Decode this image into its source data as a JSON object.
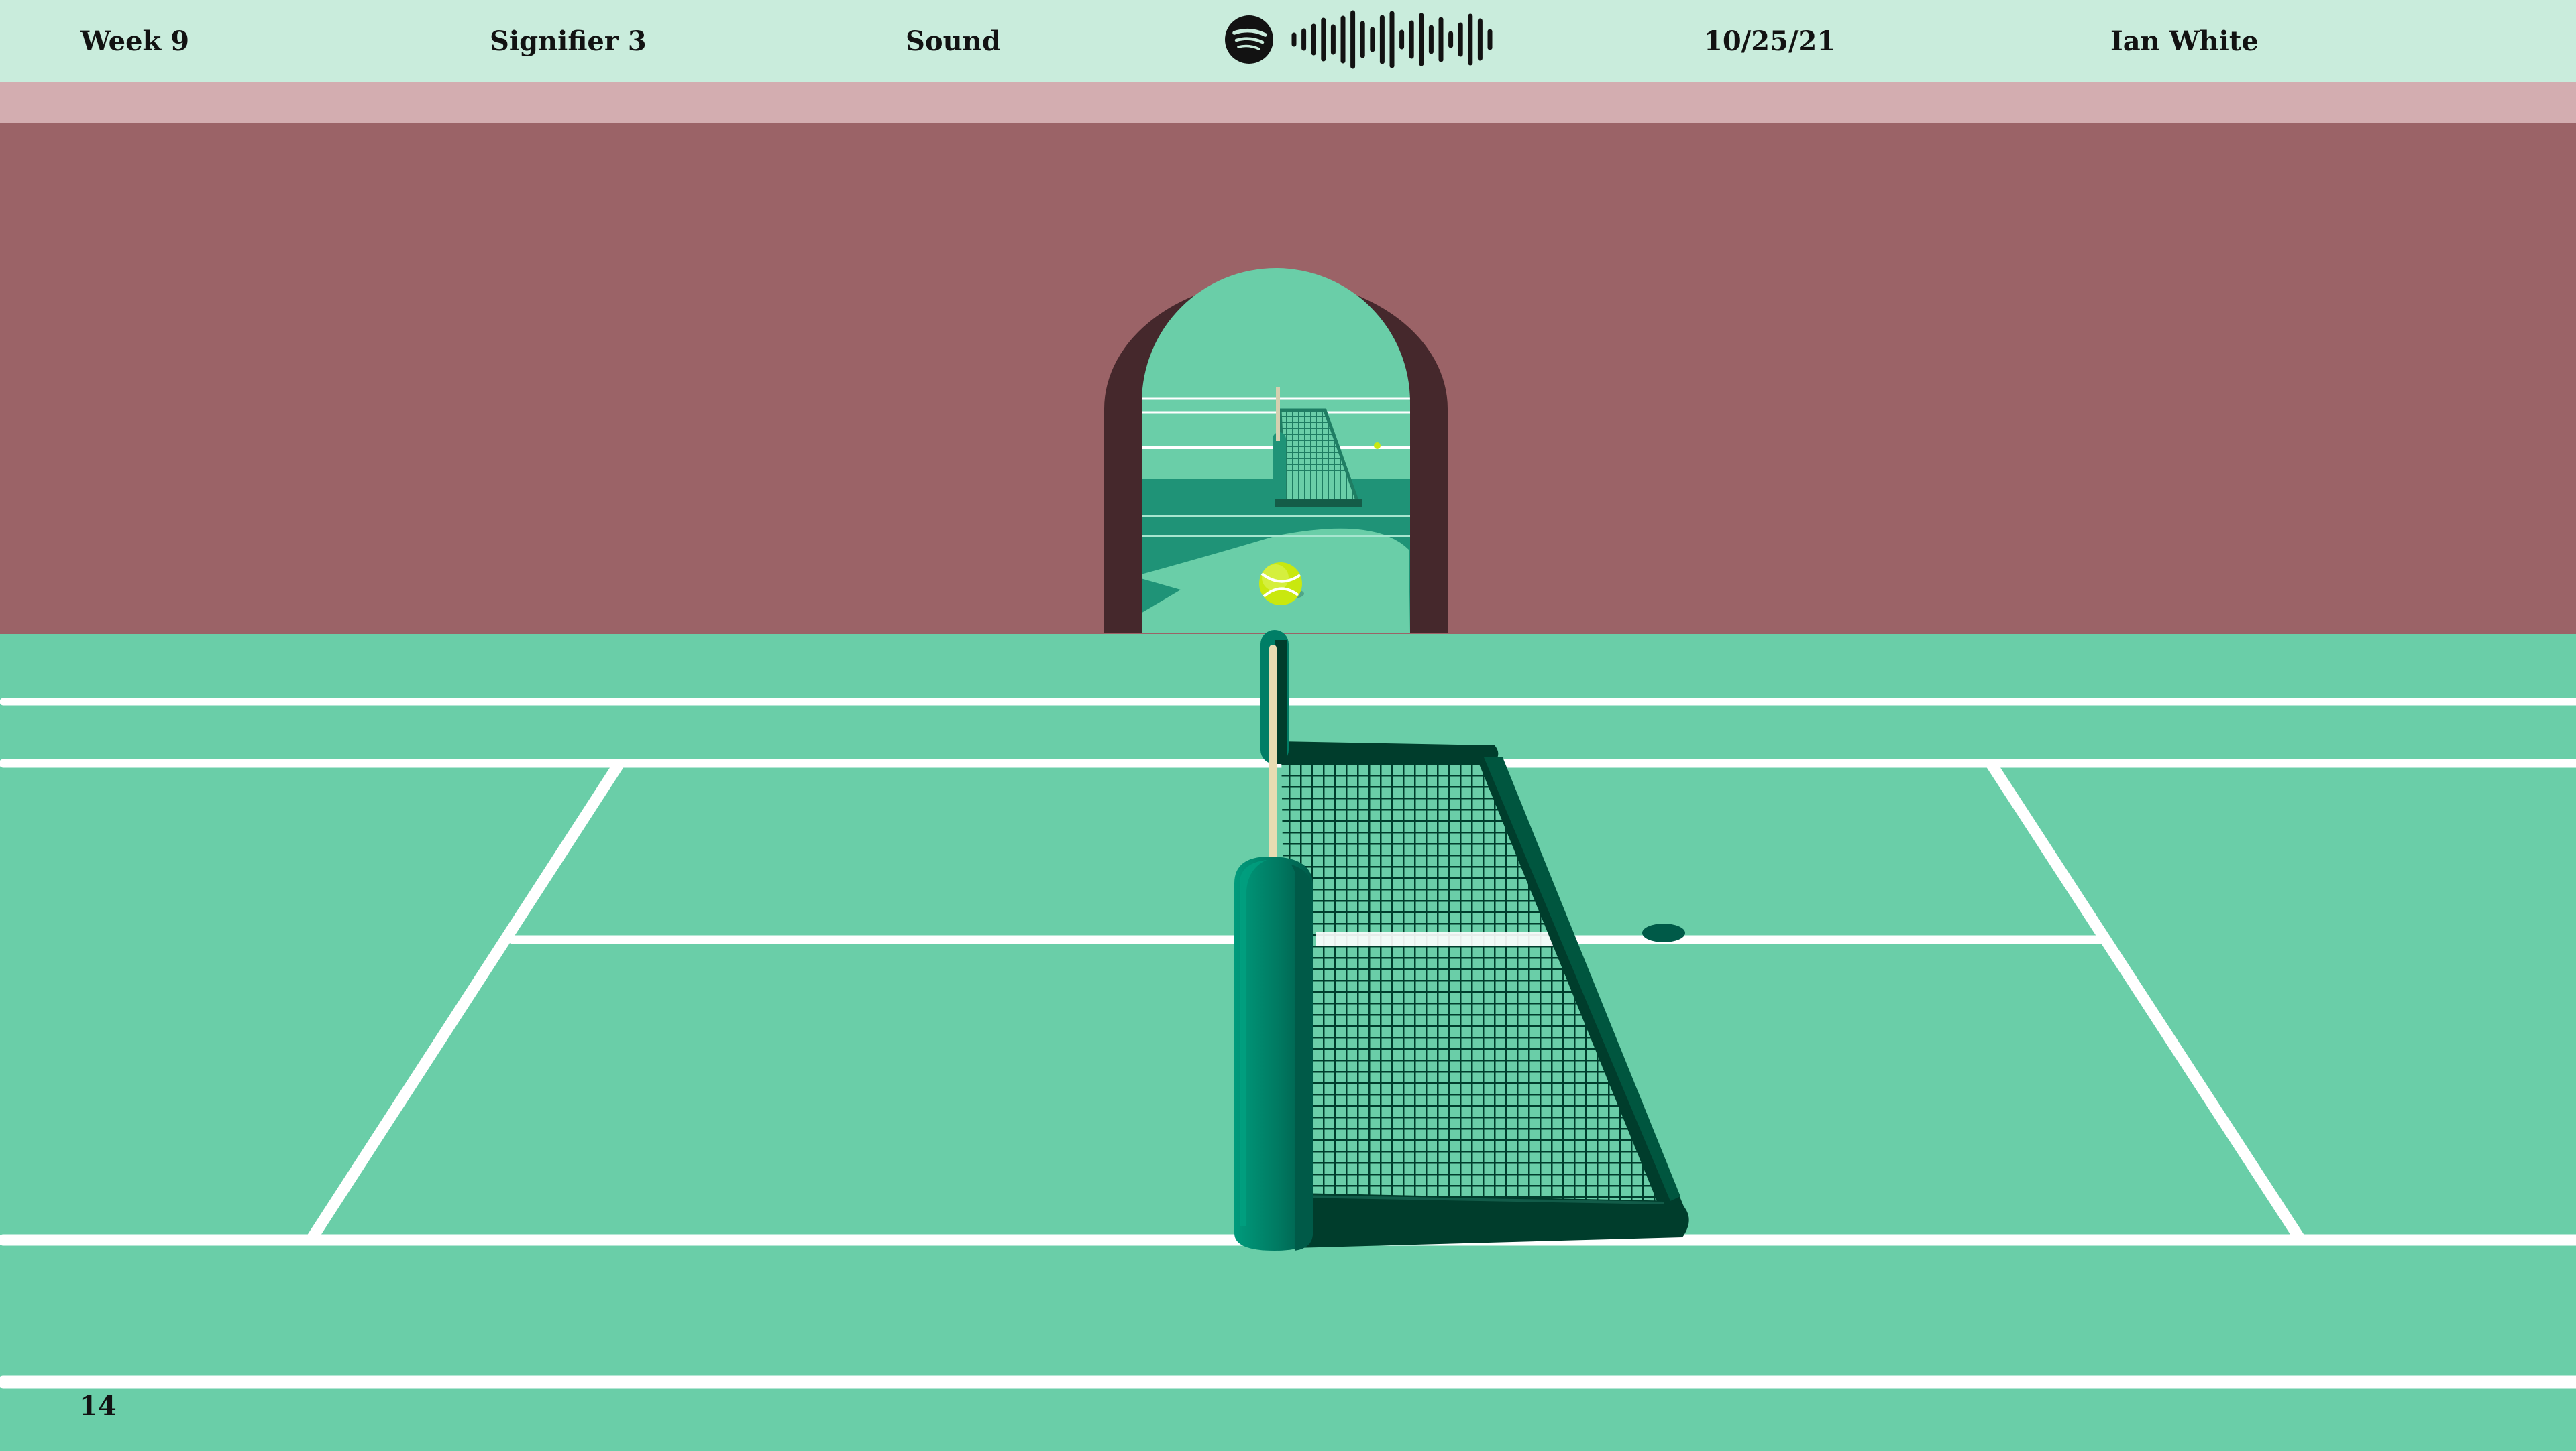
{
  "header": {
    "week": "Week 9",
    "signifier": "Signifier 3",
    "topic": "Sound",
    "date": "10/25/21",
    "author": "Ian White",
    "spotify_code_icon": "spotify-code-icon"
  },
  "footer": {
    "page_number": "14"
  },
  "scene": {
    "subject": "tennis court with net, arched doorway, tennis ball",
    "icons": [
      "spotify-logo-icon",
      "soundwave-icon",
      "tennis-ball-icon",
      "tennis-net-icon"
    ]
  },
  "colors": {
    "header_bg": "#c9ecdc",
    "wall_band": "#d3adb0",
    "wall": "#9b6367",
    "arch_frame": "#45282c",
    "court": "#6acea8",
    "court_dark": "#1f9377",
    "line": "#ffffff",
    "net_dark": "#003d2c",
    "post": "#007e66",
    "ball": "#c9e80f"
  }
}
